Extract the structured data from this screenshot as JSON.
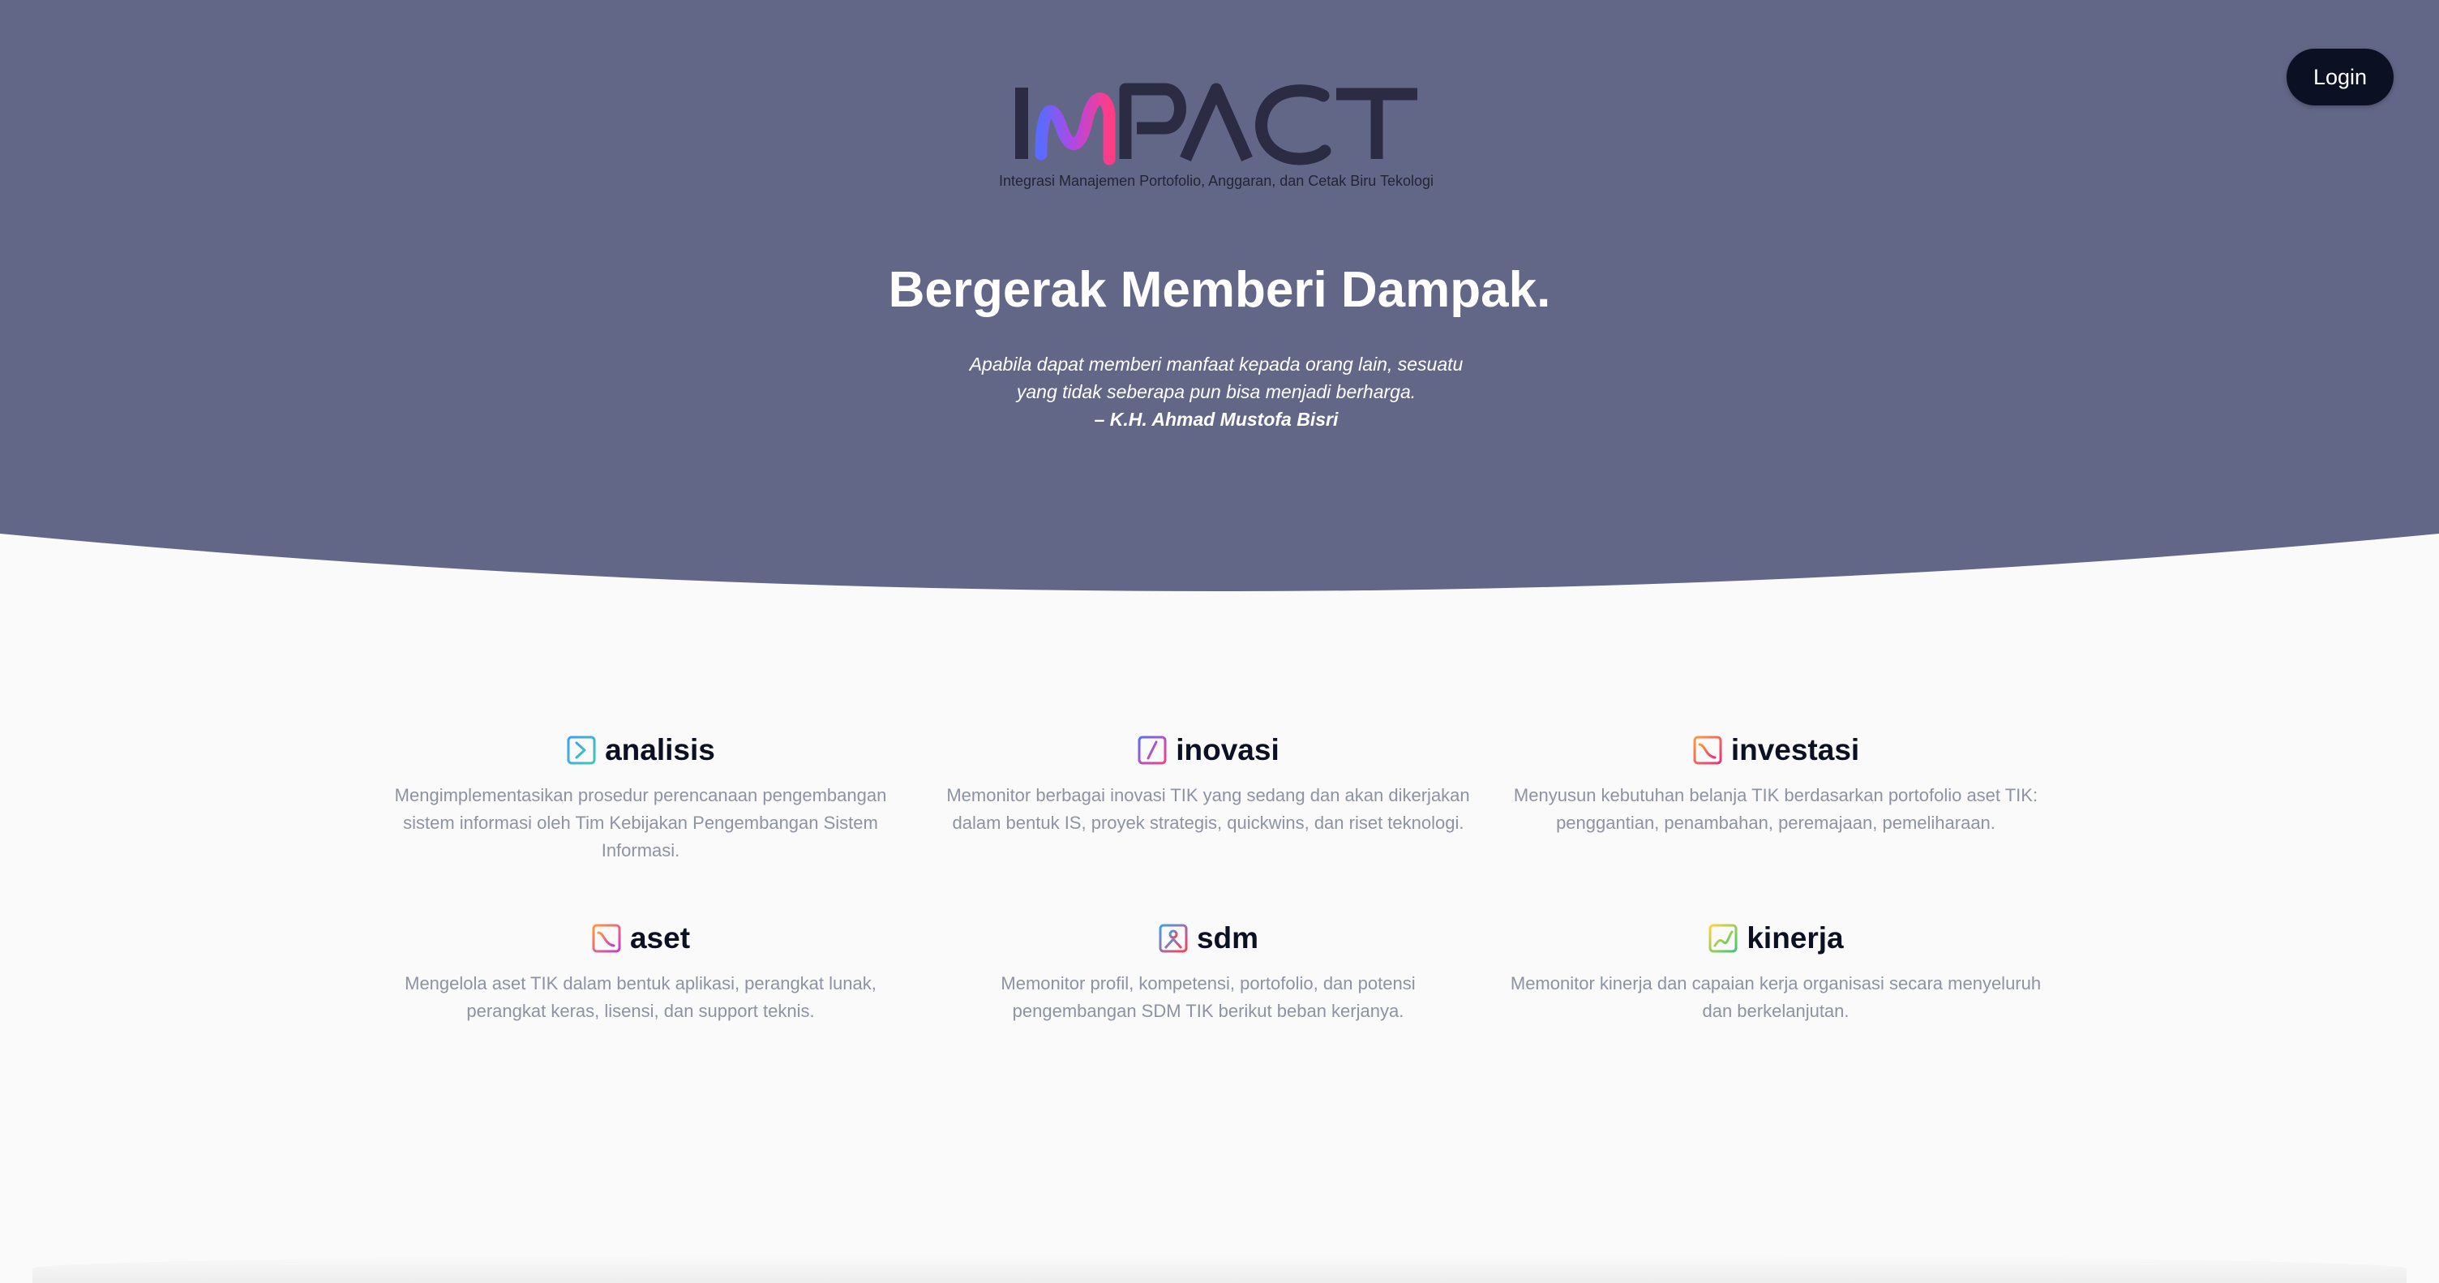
{
  "colors": {
    "hero_bg": "#636787",
    "page_bg": "#fafafa",
    "login_bg": "#0b1122",
    "title_dark": "#0b1122",
    "muted_text": "#8d93a3"
  },
  "header": {
    "login_label": "Login"
  },
  "logo": {
    "wordmark": "IMPACT",
    "tagline": "Integrasi Manajemen Portofolio, Anggaran, dan Cetak Biru Tekologi"
  },
  "hero": {
    "title": "Bergerak Memberi Dampak.",
    "quote_line1": "Apabila dapat memberi manfaat kepada orang lain, sesuatu",
    "quote_line2": "yang tidak seberapa pun bisa menjadi berharga.",
    "author": "– K.H. Ahmad Mustofa Bisri"
  },
  "features": [
    {
      "icon": "analisis-icon",
      "title": "analisis",
      "description": "Mengimplementasikan prosedur perencanaan pengembangan sistem informasi oleh Tim Kebijakan Pengembangan Sistem Informasi."
    },
    {
      "icon": "inovasi-icon",
      "title": "inovasi",
      "description": "Memonitor berbagai inovasi TIK yang sedang dan akan dikerjakan dalam bentuk IS, proyek strategis, quickwins, dan riset teknologi."
    },
    {
      "icon": "investasi-icon",
      "title": "investasi",
      "description": "Menyusun kebutuhan belanja TIK berdasarkan portofolio aset TIK: penggantian, penambahan, peremajaan, pemeliharaan."
    },
    {
      "icon": "aset-icon",
      "title": "aset",
      "description": "Mengelola aset TIK dalam bentuk aplikasi, perangkat lunak, perangkat keras, lisensi, dan support teknis."
    },
    {
      "icon": "sdm-icon",
      "title": "sdm",
      "description": "Memonitor profil, kompetensi, portofolio, dan potensi pengembangan SDM TIK berikut beban kerjanya."
    },
    {
      "icon": "kinerja-icon",
      "title": "kinerja",
      "description": "Memonitor kinerja dan capaian kerja organisasi secara menyeluruh dan berkelanjutan."
    }
  ]
}
